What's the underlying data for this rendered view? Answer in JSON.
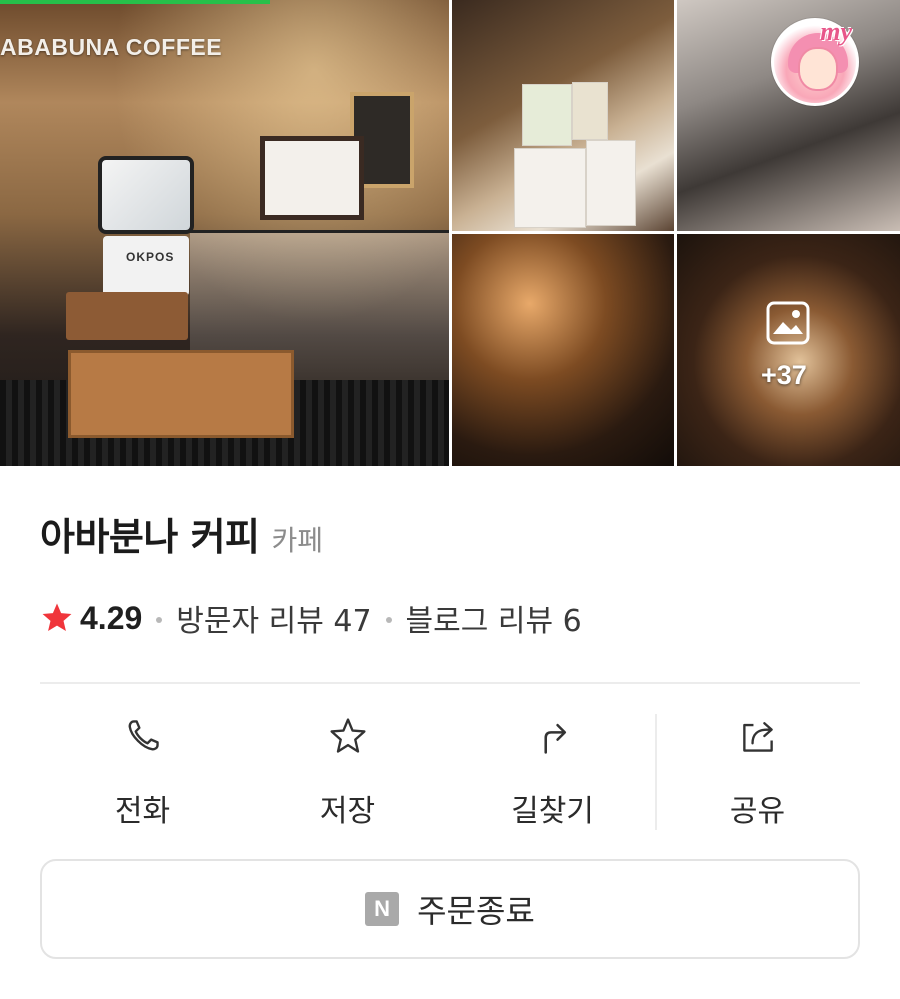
{
  "photos": {
    "storefront_sign": "ABABUNA COFFEE",
    "pos_brand": "OKPOS",
    "more_count": "+37"
  },
  "avatar": {
    "tag": "my"
  },
  "place": {
    "name": "아바분나 커피",
    "category": "카페"
  },
  "rating": {
    "value": "4.29",
    "visitor_reviews": "방문자 리뷰 47",
    "blog_reviews": "블로그 리뷰 6",
    "star_color": "#f0353b"
  },
  "actions": [
    {
      "label": "전화",
      "icon": "phone-icon"
    },
    {
      "label": "저장",
      "icon": "star-outline-icon"
    },
    {
      "label": "길찾기",
      "icon": "directions-icon"
    },
    {
      "label": "공유",
      "icon": "share-icon"
    }
  ],
  "order": {
    "badge": "N",
    "label": "주문종료"
  },
  "colors": {
    "accent_green": "#27c04a",
    "divider": "#ececec"
  }
}
